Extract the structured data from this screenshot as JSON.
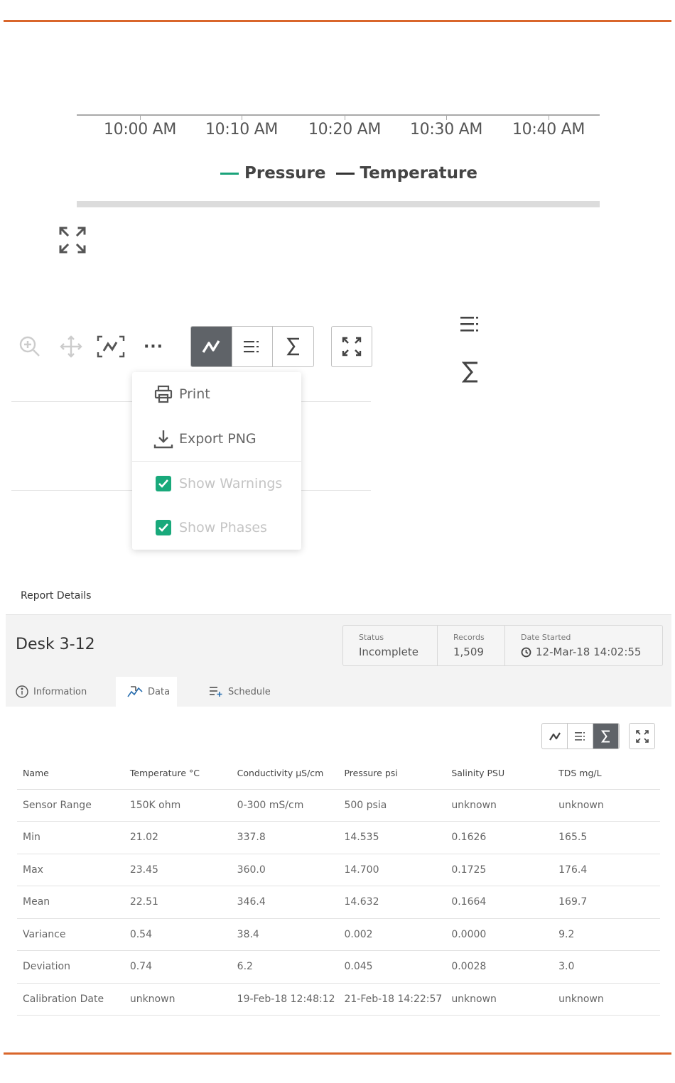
{
  "chart": {
    "ticks": [
      "10:00 AM",
      "10:10 AM",
      "10:20 AM",
      "10:30 AM",
      "10:40 AM"
    ],
    "legend": [
      {
        "label": "Pressure",
        "color": "#1aa37a"
      },
      {
        "label": "Temperature",
        "color": "#333333"
      }
    ]
  },
  "toolbar": {
    "more_label": "···",
    "icons": [
      "zoom-in-icon",
      "pan-icon",
      "select-zoom-icon",
      "more-icon",
      "line-chart-icon",
      "legend-list-icon",
      "sigma-icon",
      "fullscreen-icon"
    ]
  },
  "menu": {
    "print": "Print",
    "export_png": "Export PNG",
    "show_warnings": "Show Warnings",
    "show_phases": "Show Phases",
    "show_warnings_checked": true,
    "show_phases_checked": true
  },
  "report": {
    "section_title": "Report Details",
    "desk": "Desk 3-12",
    "stats": {
      "status_label": "Status",
      "status_value": "Incomplete",
      "records_label": "Records",
      "records_value": "1,509",
      "date_label": "Date Started",
      "date_value": "12-Mar-18 14:02:55"
    },
    "tabs": [
      {
        "label": "Information",
        "icon": "info-icon"
      },
      {
        "label": "Data",
        "icon": "data-chart-icon",
        "active": true
      },
      {
        "label": "Schedule",
        "icon": "schedule-add-icon"
      }
    ],
    "table": {
      "headers": [
        "Name",
        "Temperature °C",
        "Conductivity µS/cm",
        "Pressure psi",
        "Salinity PSU",
        "TDS mg/L"
      ],
      "rows": [
        [
          "Sensor Range",
          "150K ohm",
          "0-300 mS/cm",
          "500 psia",
          "unknown",
          "unknown"
        ],
        [
          "Min",
          "21.02",
          "337.8",
          "14.535",
          "0.1626",
          "165.5"
        ],
        [
          "Max",
          "23.45",
          "360.0",
          "14.700",
          "0.1725",
          "176.4"
        ],
        [
          "Mean",
          "22.51",
          "346.4",
          "14.632",
          "0.1664",
          "169.7"
        ],
        [
          "Variance",
          "0.54",
          "38.4",
          "0.002",
          "0.0000",
          "9.2"
        ],
        [
          "Deviation",
          "0.74",
          "6.2",
          "0.045",
          "0.0028",
          "3.0"
        ],
        [
          "Calibration Date",
          "unknown",
          "19-Feb-18 12:48:12",
          "21-Feb-18 14:22:57",
          "unknown",
          "unknown"
        ]
      ]
    }
  },
  "colors": {
    "accent_rule": "#d9662b",
    "checkbox_green": "#19a97b",
    "active_segment": "#5f6368"
  }
}
